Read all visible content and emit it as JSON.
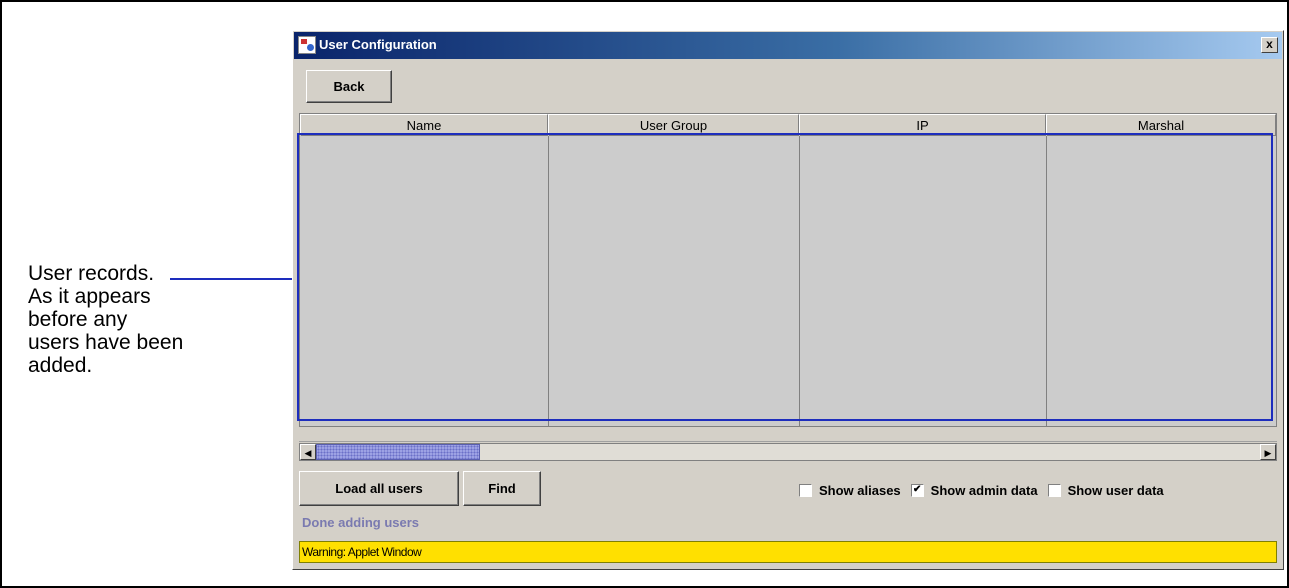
{
  "callout": {
    "text": "User records.\nAs it appears\nbefore any\nusers have been\nadded."
  },
  "window": {
    "title": "User Configuration",
    "close_label": "x"
  },
  "toolbar": {
    "back_label": "Back"
  },
  "table": {
    "columns": [
      "Name",
      "User Group",
      "IP",
      "Marshal"
    ],
    "rows": []
  },
  "actions": {
    "load_all_label": "Load all users",
    "find_label": "Find"
  },
  "options": {
    "show_aliases": {
      "label": "Show aliases",
      "checked": false
    },
    "show_admin_data": {
      "label": "Show admin data",
      "checked": true
    },
    "show_user_data": {
      "label": "Show user data",
      "checked": false
    }
  },
  "status": {
    "message": "Done adding users"
  },
  "warning": {
    "text": "Warning: Applet Window"
  },
  "colors": {
    "annotation": "#1d2dbd",
    "warning_bg": "#ffe000",
    "status_text": "#7a7ab0"
  }
}
